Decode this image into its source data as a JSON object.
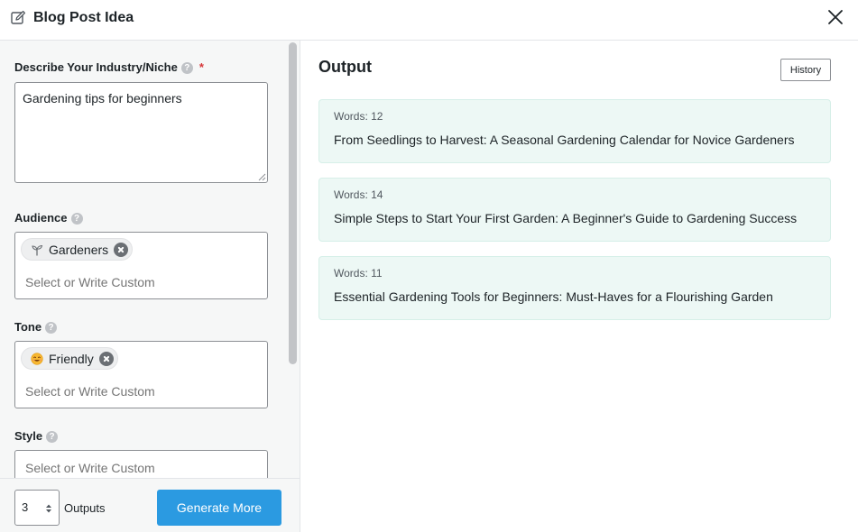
{
  "header": {
    "title": "Blog Post Idea",
    "edit_icon": "edit-icon",
    "close_icon": "close-icon"
  },
  "form": {
    "industry": {
      "label": "Describe Your Industry/Niche",
      "required_mark": "*",
      "value": "Gardening tips for beginners"
    },
    "audience": {
      "label": "Audience",
      "chip": {
        "icon": "sprout-icon",
        "label": "Gardeners"
      },
      "placeholder": "Select or Write Custom"
    },
    "tone": {
      "label": "Tone",
      "chip": {
        "icon": "smiling-face-icon",
        "label": "Friendly"
      },
      "placeholder": "Select or Write Custom"
    },
    "style": {
      "label": "Style",
      "placeholder": "Select or Write Custom"
    }
  },
  "footer": {
    "outputs_count": "3",
    "outputs_label": "Outputs",
    "generate_label": "Generate More"
  },
  "output": {
    "title": "Output",
    "history_label": "History",
    "results": [
      {
        "words": "Words: 12",
        "text": "From Seedlings to Harvest: A Seasonal Gardening Calendar for Novice Gardeners"
      },
      {
        "words": "Words: 14",
        "text": "Simple Steps to Start Your First Garden: A Beginner's Guide to Gardening Success"
      },
      {
        "words": "Words: 11",
        "text": "Essential Gardening Tools for Beginners: Must-Haves for a Flourishing Garden"
      }
    ]
  },
  "colors": {
    "accent": "#2b9ae1",
    "result_bg": "#edf8f5",
    "required": "#d63638",
    "panel_bg": "#f6f7f7"
  }
}
